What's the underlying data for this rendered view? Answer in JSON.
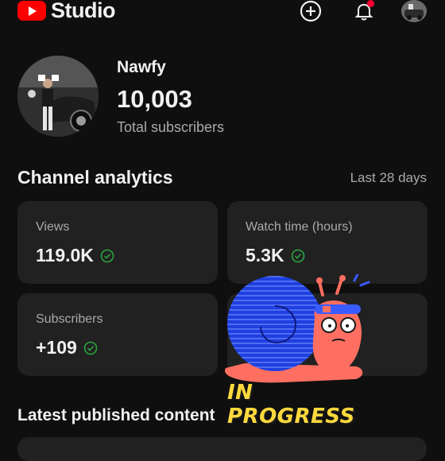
{
  "header": {
    "app_name": "Studio",
    "icons": [
      "youtube-logo-icon",
      "create-plus-icon",
      "notification-bell-icon",
      "account-avatar"
    ],
    "accent": "#ff0000",
    "notification_dot_color": "#ff0033"
  },
  "channel": {
    "name": "Nawfy",
    "subscriber_count": "10,003",
    "subscriber_label": "Total subscribers"
  },
  "analytics": {
    "title": "Channel analytics",
    "range": "Last 28 days",
    "cards": [
      {
        "label": "Views",
        "value": "119.0K"
      },
      {
        "label": "Watch time (hours)",
        "value": "5.3K"
      },
      {
        "label": "Subscribers",
        "value": "+109"
      }
    ],
    "status_color": "#2ba640"
  },
  "sticker": {
    "text": "IN PROGRESS",
    "icon": "snail-sticker"
  },
  "latest": {
    "title": "Latest published content"
  }
}
